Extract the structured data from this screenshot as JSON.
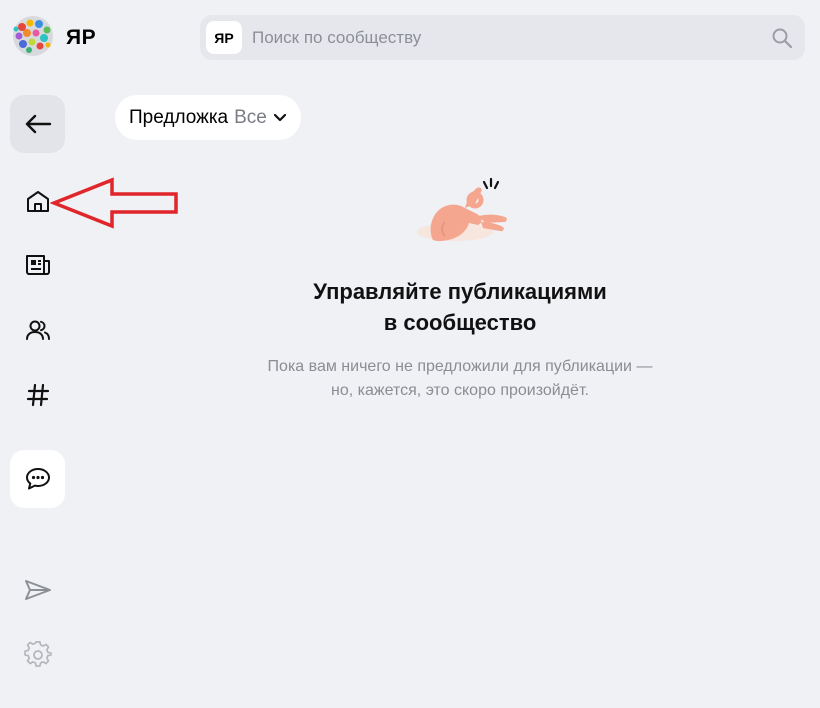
{
  "header": {
    "brand": "ЯР",
    "search": {
      "badge": "ЯР",
      "placeholder": "Поиск по сообществу"
    }
  },
  "sidebar": {
    "items": [
      {
        "icon": "back-arrow-icon"
      },
      {
        "icon": "home-icon"
      },
      {
        "icon": "newspaper-icon"
      },
      {
        "icon": "users-icon"
      },
      {
        "icon": "hashtag-icon"
      },
      {
        "icon": "chat-icon"
      },
      {
        "icon": "send-icon"
      },
      {
        "icon": "gear-icon"
      }
    ]
  },
  "filter": {
    "label": "Предложка",
    "selected": "Все"
  },
  "empty_state": {
    "title_line1": "Управляйте публикациями",
    "title_line2": "в сообщество",
    "text_line1": "Пока вам ничего не предложили для публикации —",
    "text_line2": "но, кажется, это скоро произойдёт."
  },
  "colors": {
    "background": "#f0f1f5",
    "annotation_arrow": "#e0262b",
    "muted_text": "#8a8d94"
  }
}
